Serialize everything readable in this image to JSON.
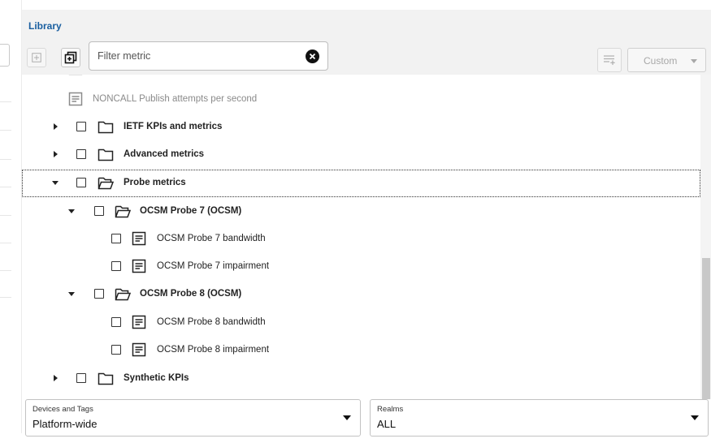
{
  "library": {
    "title": "Library",
    "filter_placeholder": "Filter metric",
    "custom_label": "Custom"
  },
  "icons": {
    "add": "plus-square-icon",
    "expand_all": "expand-all-icon",
    "clear": "clear-circle-icon",
    "add_list": "add-list-icon",
    "folder": "folder-icon",
    "folder_open": "folder-open-icon",
    "metric": "metric-document-icon"
  },
  "tree": {
    "partial_row": "",
    "noncall": "NONCALL Publish attempts per second",
    "ietf": "IETF KPIs and metrics",
    "advanced": "Advanced metrics",
    "probe": "Probe metrics",
    "ocsm7": "OCSM Probe 7 (OCSM)",
    "ocsm7_bw": "OCSM Probe 7 bandwidth",
    "ocsm7_imp": "OCSM Probe 7 impairment",
    "ocsm8": "OCSM Probe 8 (OCSM)",
    "ocsm8_bw": "OCSM Probe 8 bandwidth",
    "ocsm8_imp": "OCSM Probe 8 impairment",
    "synthetic": "Synthetic KPIs"
  },
  "selectors": {
    "devices_caption": "Devices and Tags",
    "devices_value": "Platform-wide",
    "realms_caption": "Realms",
    "realms_value": "ALL"
  },
  "colors": {
    "title_blue": "#1a5fa0",
    "header_bg": "#f2f2f2"
  }
}
